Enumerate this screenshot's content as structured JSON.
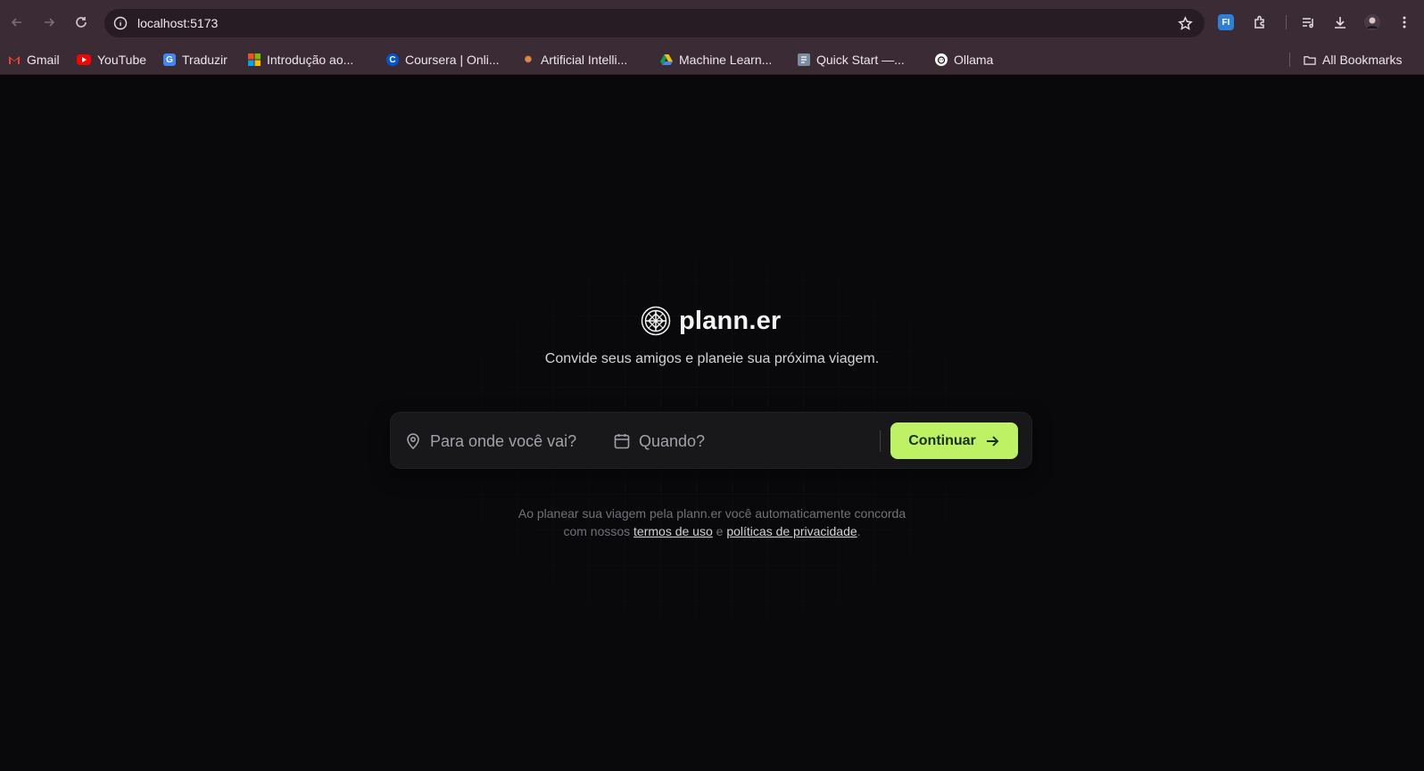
{
  "browser": {
    "url": "localhost:5173",
    "extension_badge": "FI",
    "bookmarks": [
      {
        "label": "Gmail",
        "icon": "gmail-icon"
      },
      {
        "label": "YouTube",
        "icon": "youtube-icon"
      },
      {
        "label": "Traduzir",
        "icon": "translate-icon"
      },
      {
        "label": "Introdução ao...",
        "icon": "microsoft-icon"
      },
      {
        "label": "Coursera | Onli...",
        "icon": "coursera-icon"
      },
      {
        "label": "Artificial Intelli...",
        "icon": "ai-icon"
      },
      {
        "label": "Machine Learn...",
        "icon": "drive-icon"
      },
      {
        "label": "Quick Start —...",
        "icon": "docs-icon"
      },
      {
        "label": "Ollama",
        "icon": "ollama-icon"
      }
    ],
    "all_bookmarks_label": "All Bookmarks"
  },
  "app": {
    "name": "plann.er",
    "subtitle": "Convide seus amigos e planeie sua próxima viagem.",
    "destination_placeholder": "Para onde você vai?",
    "date_placeholder": "Quando?",
    "continue_label": "Continuar",
    "terms_line1": "Ao planear sua viagem pela plann.er você automaticamente concorda",
    "terms_prefix": "com nossos",
    "terms_link": "termos de uso",
    "terms_and": "e",
    "privacy_link": "políticas de privacidade",
    "terms_suffix": "."
  },
  "colors": {
    "accent": "#bef264",
    "background": "#09090b",
    "toolbar": "#3a2b34"
  }
}
